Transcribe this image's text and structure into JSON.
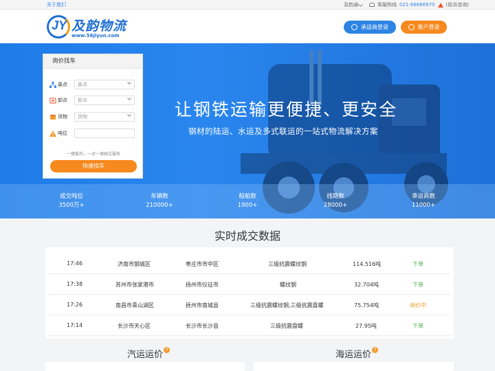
{
  "topbar": {
    "about": "关于我们",
    "user": "及韵通",
    "hotline_label": "客服热线",
    "phone": "021-66886970",
    "complaint": "(投诉咨询)"
  },
  "header": {
    "logo_cn": "及韵物流",
    "logo_url": "www.56jiyun.com",
    "carrier_login": "承运商登录",
    "client_login": "客户登录"
  },
  "hero": {
    "title": "让钢铁运输更便捷、更安全",
    "subtitle": "钢材的陆运、水运及多式联运的一站式物流解决方案",
    "stats": [
      {
        "label": "成交吨位",
        "value": "3500万+"
      },
      {
        "label": "车辆数",
        "value": "210000+"
      },
      {
        "label": "船舶数",
        "value": "1900+"
      },
      {
        "label": "线路数",
        "value": "28000+"
      },
      {
        "label": "承运商数",
        "value": "11000+"
      }
    ]
  },
  "panel": {
    "title": "询价找车",
    "fields": [
      {
        "label": "装点",
        "placeholder": "装点"
      },
      {
        "label": "卸点",
        "placeholder": "卸点"
      },
      {
        "label": "货物",
        "placeholder": "货物"
      },
      {
        "label": "吨位",
        "placeholder": ""
      }
    ],
    "note": "一键委托，一对一保姆式服务",
    "button": "快速找车"
  },
  "realtime": {
    "title": "实时成交数据",
    "rows": [
      {
        "time": "17:46",
        "from": "济南市钢城区",
        "to": "枣庄市市中区",
        "cargo": "三级抗震螺纹钢",
        "weight": "114.516吨",
        "status": "下单",
        "color": "#4caf50"
      },
      {
        "time": "17:38",
        "from": "苏州市张家港市",
        "to": "扬州市仪征市",
        "cargo": "螺纹钢",
        "weight": "32.704吨",
        "status": "下单",
        "color": "#4caf50"
      },
      {
        "time": "17:26",
        "from": "南昌市青山湖区",
        "to": "抚州市南城县",
        "cargo": "三级抗震螺纹钢,三级抗震盘螺",
        "weight": "75.754吨",
        "status": "询价中",
        "color": "#f29b2e"
      },
      {
        "time": "17:14",
        "from": "长沙市天心区",
        "to": "长沙市长沙县",
        "cargo": "三级抗震盘螺",
        "weight": "27.95吨",
        "status": "下单",
        "color": "#4caf50"
      }
    ]
  },
  "sections": {
    "truck_freight": "汽运运价",
    "sea_freight": "海运运价",
    "help": "?"
  },
  "colors": {
    "primary": "#1f6fd0",
    "accent": "#f7891e",
    "hero": "#2a86ee"
  }
}
